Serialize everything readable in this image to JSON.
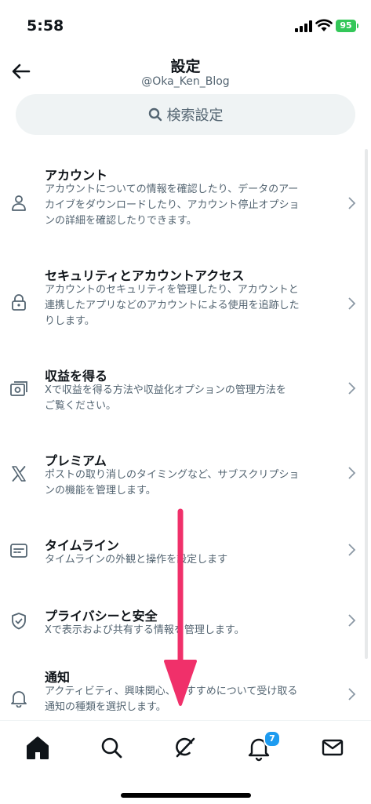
{
  "status": {
    "time": "5:58",
    "battery": "95"
  },
  "header": {
    "title": "設定",
    "username": "@Oka_Ken_Blog",
    "back_icon": "arrow-left-icon"
  },
  "search": {
    "placeholder": "検索設定",
    "icon": "search-icon"
  },
  "settings": [
    {
      "label": "アカウント",
      "desc_lines": [
        "アカウントについての情報を確認したり、データのアー",
        "カイブをダウンロードしたり、アカウント停止オプショ",
        "ンの詳細を確認したりできます。"
      ],
      "icon": "person-icon"
    },
    {
      "label": "セキュリティとアカウントアクセス",
      "desc_lines": [
        "アカウントのセキュリティを管理したり、アカウントと",
        "連携したアプリなどのアカウントによる使用を追跡した",
        "りします。"
      ],
      "icon": "lock-icon"
    },
    {
      "label": "収益を得る",
      "desc_lines": [
        "Xで収益を得る方法や収益化オプションの管理方法を",
        "ご覧ください。"
      ],
      "icon": "money-icon"
    },
    {
      "label": "プレミアム",
      "desc_lines": [
        "ポストの取り消しのタイミングなど、サブスクリプショ",
        "ンの機能を管理します。"
      ],
      "icon": "x-logo-icon"
    },
    {
      "label": "タイムライン",
      "desc_lines": [
        "タイムラインの外観と操作を設定します"
      ],
      "icon": "timeline-icon"
    },
    {
      "label": "プライバシーと安全",
      "desc_lines": [
        "Xで表示および共有する情報を管理します。"
      ],
      "icon": "shield-icon"
    },
    {
      "label": "通知",
      "desc_lines": [
        "アクティビティ、興味関心、おすすめについて受け取る",
        "通知の種類を選択します。"
      ],
      "icon": "bell-icon"
    }
  ],
  "tabbar": {
    "tabs": [
      "home-icon",
      "search-icon",
      "grok-icon",
      "bell-icon",
      "mail-icon"
    ],
    "notification_count": "7"
  },
  "colors": {
    "text": "#0f1419",
    "secondary": "#536471",
    "search_bg": "#eff3f4",
    "badge": "#1d9bf0",
    "annotation_arrow": "#f0306a",
    "battery": "#34c759"
  }
}
